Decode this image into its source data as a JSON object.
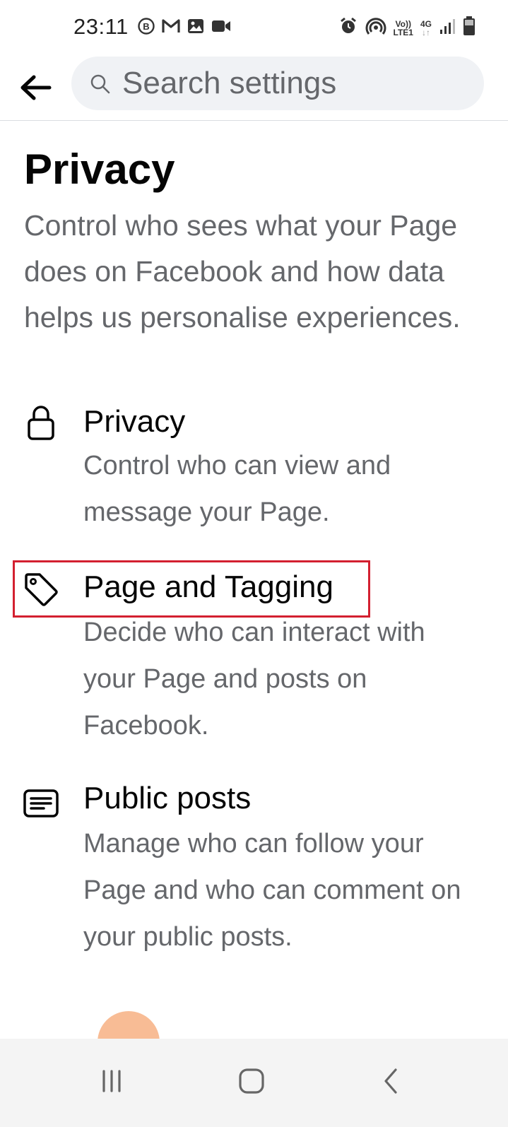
{
  "status_bar": {
    "time": "23:11",
    "left_icons": [
      "whatsapp-business-icon",
      "gmail-icon",
      "gallery-icon",
      "video-icon"
    ],
    "right_icons": [
      "alarm-icon",
      "hotspot-icon",
      "volte-icon",
      "4g-icon",
      "signal-icon",
      "battery-icon"
    ],
    "volte_label_top": "Vo))",
    "volte_label_bottom": "LTE1",
    "network_label": "4G"
  },
  "header": {
    "search_placeholder": "Search settings"
  },
  "page": {
    "title": "Privacy",
    "description": "Control who sees what your Page does on Facebook and how data helps us personalise experiences."
  },
  "items": [
    {
      "title": "Privacy",
      "description": "Control who can view and message your Page.",
      "icon": "lock-icon"
    },
    {
      "title": "Page and Tagging",
      "description": "Decide who can interact with your Page and posts on Facebook.",
      "icon": "tag-icon"
    },
    {
      "title": "Public posts",
      "description": "Manage who can follow your Page and who can comment on your public posts.",
      "icon": "post-icon"
    }
  ],
  "colors": {
    "primary_text": "#050505",
    "secondary_text": "#65676b",
    "search_bg": "#f0f2f5",
    "highlight": "#d32030"
  }
}
